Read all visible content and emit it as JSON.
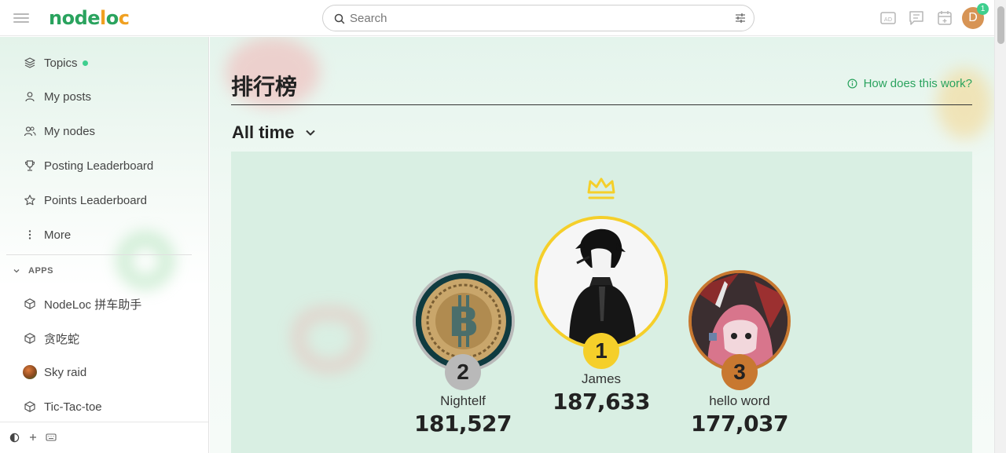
{
  "header": {
    "logo_a": "node",
    "logo_b": "l",
    "logo_c": "o",
    "logo_d": "c",
    "search_placeholder": "Search",
    "avatar_letter": "D",
    "notification_count": "1"
  },
  "sidebar": {
    "items": [
      {
        "label": "Topics",
        "icon": "layers-icon"
      },
      {
        "label": "My posts",
        "icon": "user-icon"
      },
      {
        "label": "My nodes",
        "icon": "users-icon"
      },
      {
        "label": "Posting Leaderboard",
        "icon": "trophy-icon"
      },
      {
        "label": "Points Leaderboard",
        "icon": "star-icon"
      },
      {
        "label": "More",
        "icon": "vertical-dots-icon"
      }
    ],
    "apps_heading": "APPS",
    "apps": [
      {
        "label": "NodeLoc 拼车助手",
        "icon": "cube-icon"
      },
      {
        "label": "贪吃蛇",
        "icon": "cube-icon"
      },
      {
        "label": "Sky raid",
        "icon": "app-avatar"
      },
      {
        "label": "Tic-Tac-toe",
        "icon": "cube-icon"
      }
    ]
  },
  "main": {
    "title": "排行榜",
    "how_link": "How does this work?",
    "period": "All time",
    "podium": [
      {
        "rank": "1",
        "name": "James",
        "score": "187,633"
      },
      {
        "rank": "2",
        "name": "Nightelf",
        "score": "181,527"
      },
      {
        "rank": "3",
        "name": "hello word",
        "score": "177,037"
      }
    ]
  },
  "colors": {
    "brand_green": "#2aa35e",
    "brand_orange": "#f0a020",
    "gold": "#f5cf2a",
    "silver": "#b9b9b9",
    "bronze": "#c87830",
    "online_dot": "#3ecf8e"
  }
}
